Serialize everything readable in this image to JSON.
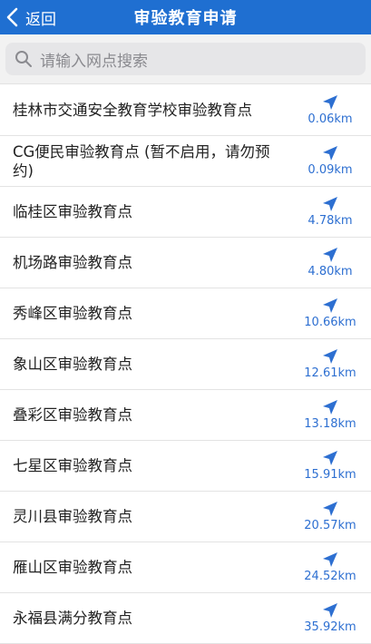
{
  "header": {
    "back_label": "返回",
    "title": "审验教育申请"
  },
  "search": {
    "placeholder": "请输入网点搜索"
  },
  "icons": {
    "back": "chevron-left-icon",
    "search": "search-icon",
    "location": "navigation-arrow-icon"
  },
  "colors": {
    "accent": "#1f6fd1",
    "distance": "#2d6fd1"
  },
  "items": [
    {
      "name": "桂林市交通安全教育学校审验教育点",
      "distance": "0.06km"
    },
    {
      "name": "CG便民审验教育点 (暂不启用，请勿预约)",
      "distance": "0.09km"
    },
    {
      "name": "临桂区审验教育点",
      "distance": "4.78km"
    },
    {
      "name": "机场路审验教育点",
      "distance": "4.80km"
    },
    {
      "name": "秀峰区审验教育点",
      "distance": "10.66km"
    },
    {
      "name": "象山区审验教育点",
      "distance": "12.61km"
    },
    {
      "name": "叠彩区审验教育点",
      "distance": "13.18km"
    },
    {
      "name": "七星区审验教育点",
      "distance": "15.91km"
    },
    {
      "name": "灵川县审验教育点",
      "distance": "20.57km"
    },
    {
      "name": "雁山区审验教育点",
      "distance": "24.52km"
    },
    {
      "name": "永福县满分教育点",
      "distance": "35.92km"
    }
  ]
}
